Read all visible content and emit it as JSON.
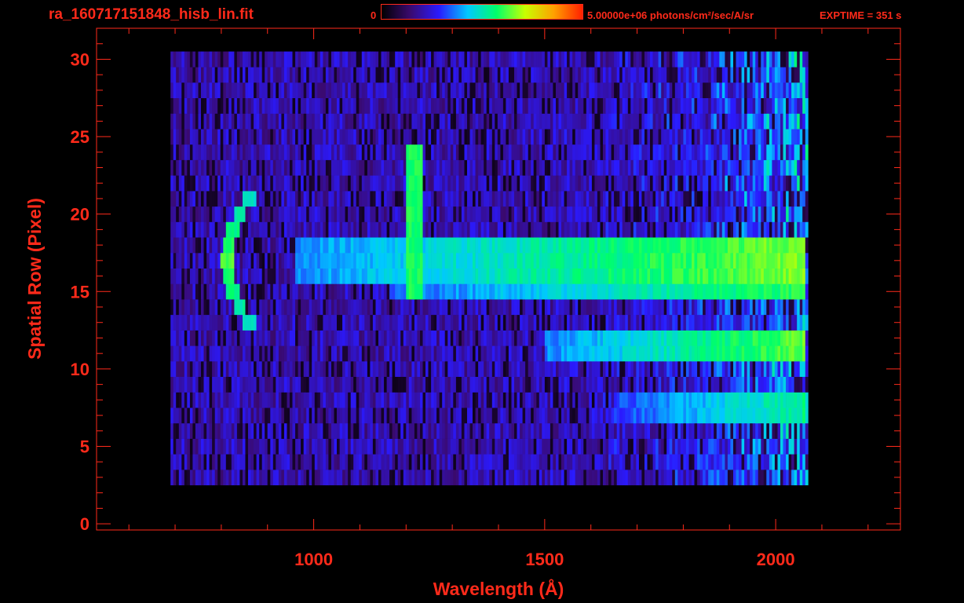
{
  "header": {
    "filename": "ra_160717151848_hisb_lin.fit",
    "colorbar_min": "0",
    "colorbar_max": "5.00000e+06 photons/cm²/sec/A/sr",
    "exptime": "EXPTIME = 351 s"
  },
  "colors": {
    "axis": "#ff2a1a",
    "background": "#000000",
    "colormap": [
      "#000000",
      "#3a0a6e",
      "#2a1aff",
      "#00c8ff",
      "#00ff6a",
      "#c8ff00",
      "#ffa000",
      "#ff2000"
    ]
  },
  "chart_data": {
    "type": "heatmap",
    "title": "",
    "xlabel": "Wavelength (Å)",
    "ylabel": "Spatial Row (Pixel)",
    "xlim": [
      530,
      2270
    ],
    "ylim": [
      -0.4,
      32
    ],
    "xticks": [
      1000,
      1500,
      2000
    ],
    "yticks": [
      0,
      5,
      10,
      15,
      20,
      25,
      30
    ],
    "grid": false,
    "colorbar": {
      "min": 0,
      "max": 5000000,
      "units": "photons/cm²/sec/A/sr",
      "placement": "top"
    },
    "signal_extent": {
      "x_start": 690,
      "x_end": 2065,
      "row_min": 3,
      "row_max": 30
    },
    "features": [
      {
        "name_shown": false,
        "kind": "continuum",
        "rows": [
          16,
          18
        ],
        "x_start": 955,
        "x_end": 2060,
        "peak": 0.62
      },
      {
        "name_shown": false,
        "kind": "continuum",
        "rows": [
          15,
          17
        ],
        "x_start": 1160,
        "x_end": 2060,
        "peak": 0.56
      },
      {
        "name_shown": false,
        "kind": "continuum",
        "rows": [
          11,
          12
        ],
        "x_start": 1500,
        "x_end": 2060,
        "peak": 0.6
      },
      {
        "name_shown": false,
        "kind": "continuum",
        "rows": [
          7,
          8
        ],
        "x_start": 1650,
        "x_end": 2060,
        "peak": 0.5
      },
      {
        "name_shown": false,
        "kind": "line",
        "x": 1215,
        "rows": [
          15,
          24
        ],
        "peak": 0.55
      },
      {
        "name_shown": false,
        "kind": "arc",
        "rows": [
          13,
          21
        ],
        "x_center_row": 17,
        "x_min": 810,
        "x_max": 858,
        "peak": 0.6
      }
    ]
  }
}
